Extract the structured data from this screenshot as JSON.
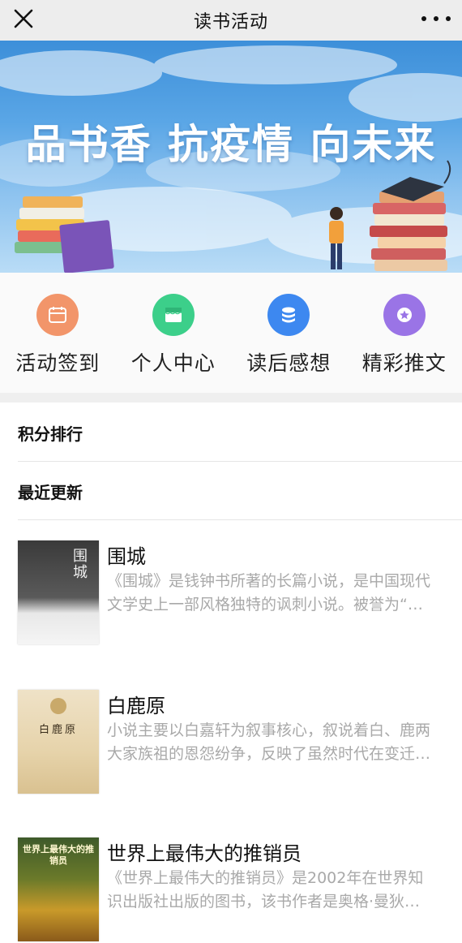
{
  "nav": {
    "title": "读书活动",
    "close_icon": "close-icon",
    "more_icon": "more-dots-icon"
  },
  "banner": {
    "headline": "品书香 抗疫情 向未来",
    "indicator_color": "#19c26a"
  },
  "quick_menu": [
    {
      "label": "活动签到",
      "icon": "calendar-icon",
      "color": "#f2956a"
    },
    {
      "label": "个人中心",
      "icon": "store-icon",
      "color": "#3ccf8a"
    },
    {
      "label": "读后感想",
      "icon": "database-icon",
      "color": "#3d88f0"
    },
    {
      "label": "精彩推文",
      "icon": "star-badge-icon",
      "color": "#9a74e6"
    }
  ],
  "sections": {
    "ranking": "积分排行",
    "recent": "最近更新"
  },
  "books": [
    {
      "title": "围城",
      "description": "《围城》是钱钟书所著的长篇小说，是中国现代文学史上一部风格独特的讽刺小说。被誉为“新儒林外史”。",
      "cover_text": "围城"
    },
    {
      "title": "白鹿原",
      "description": "小说主要以白嘉轩为叙事核心，叙说着白、鹿两大家族祖的恩怨纷争，反映了虽然时代在变迁，但传统依旧。",
      "cover_text": "白鹿原"
    },
    {
      "title": "世界上最伟大的推销员",
      "description": "《世界上最伟大的推销员》是2002年在世界知识出版社出版的图书，该书作者是奥格·曼狄诺。",
      "cover_text": "世界上最伟大的推销员"
    }
  ]
}
